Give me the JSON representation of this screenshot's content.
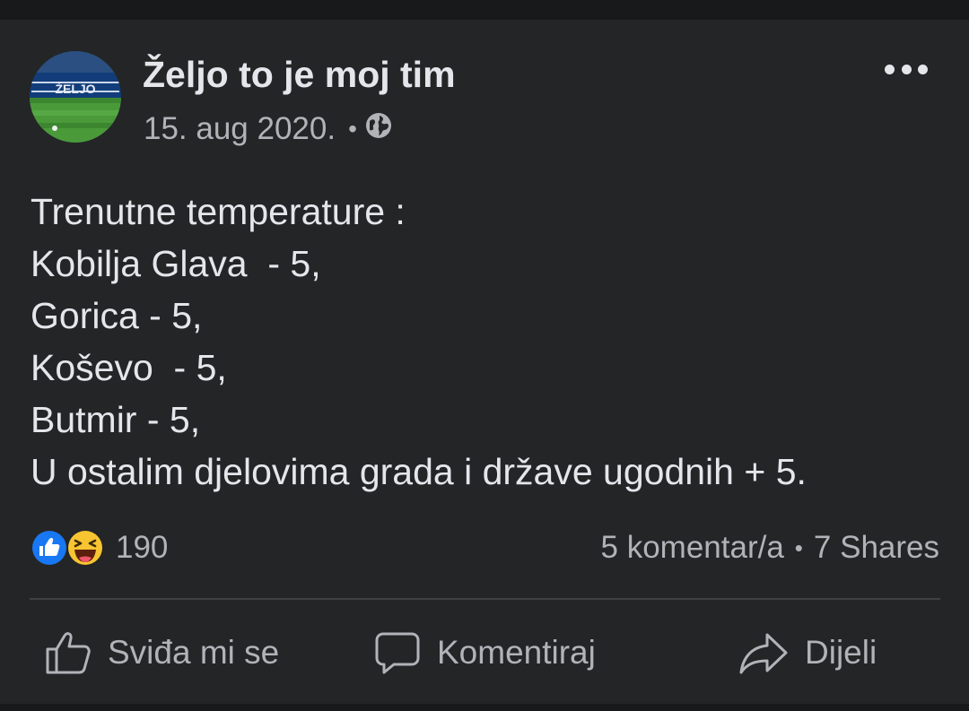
{
  "post": {
    "page_name": "Željo to je moj tim",
    "date": "15. aug 2020.",
    "separator": "•",
    "audience_icon": "globe-icon",
    "menu_icon": "more-options-icon",
    "avatar_text": "ŽELJO",
    "body_lines": [
      "Trenutne temperature :",
      "Kobilja Glava  - 5,",
      "Gorica - 5,",
      "Koševo  - 5,",
      "Butmir - 5,",
      "U ostalim djelovima grada i države ugodnih + 5."
    ]
  },
  "engagement": {
    "reaction_icons": [
      "like-reaction-icon",
      "haha-reaction-icon"
    ],
    "reaction_count": "190",
    "comments": "5 komentar/a",
    "separator": "•",
    "shares": "7 Shares"
  },
  "actions": {
    "like": "Sviđa mi se",
    "comment": "Komentiraj",
    "share": "Dijeli"
  },
  "colors": {
    "background": "#18191a",
    "card": "#242526",
    "primary_text": "#e4e6eb",
    "secondary_text": "#b0b3b8",
    "like_blue": "#1877f2",
    "haha_yellow": "#f7c531"
  }
}
